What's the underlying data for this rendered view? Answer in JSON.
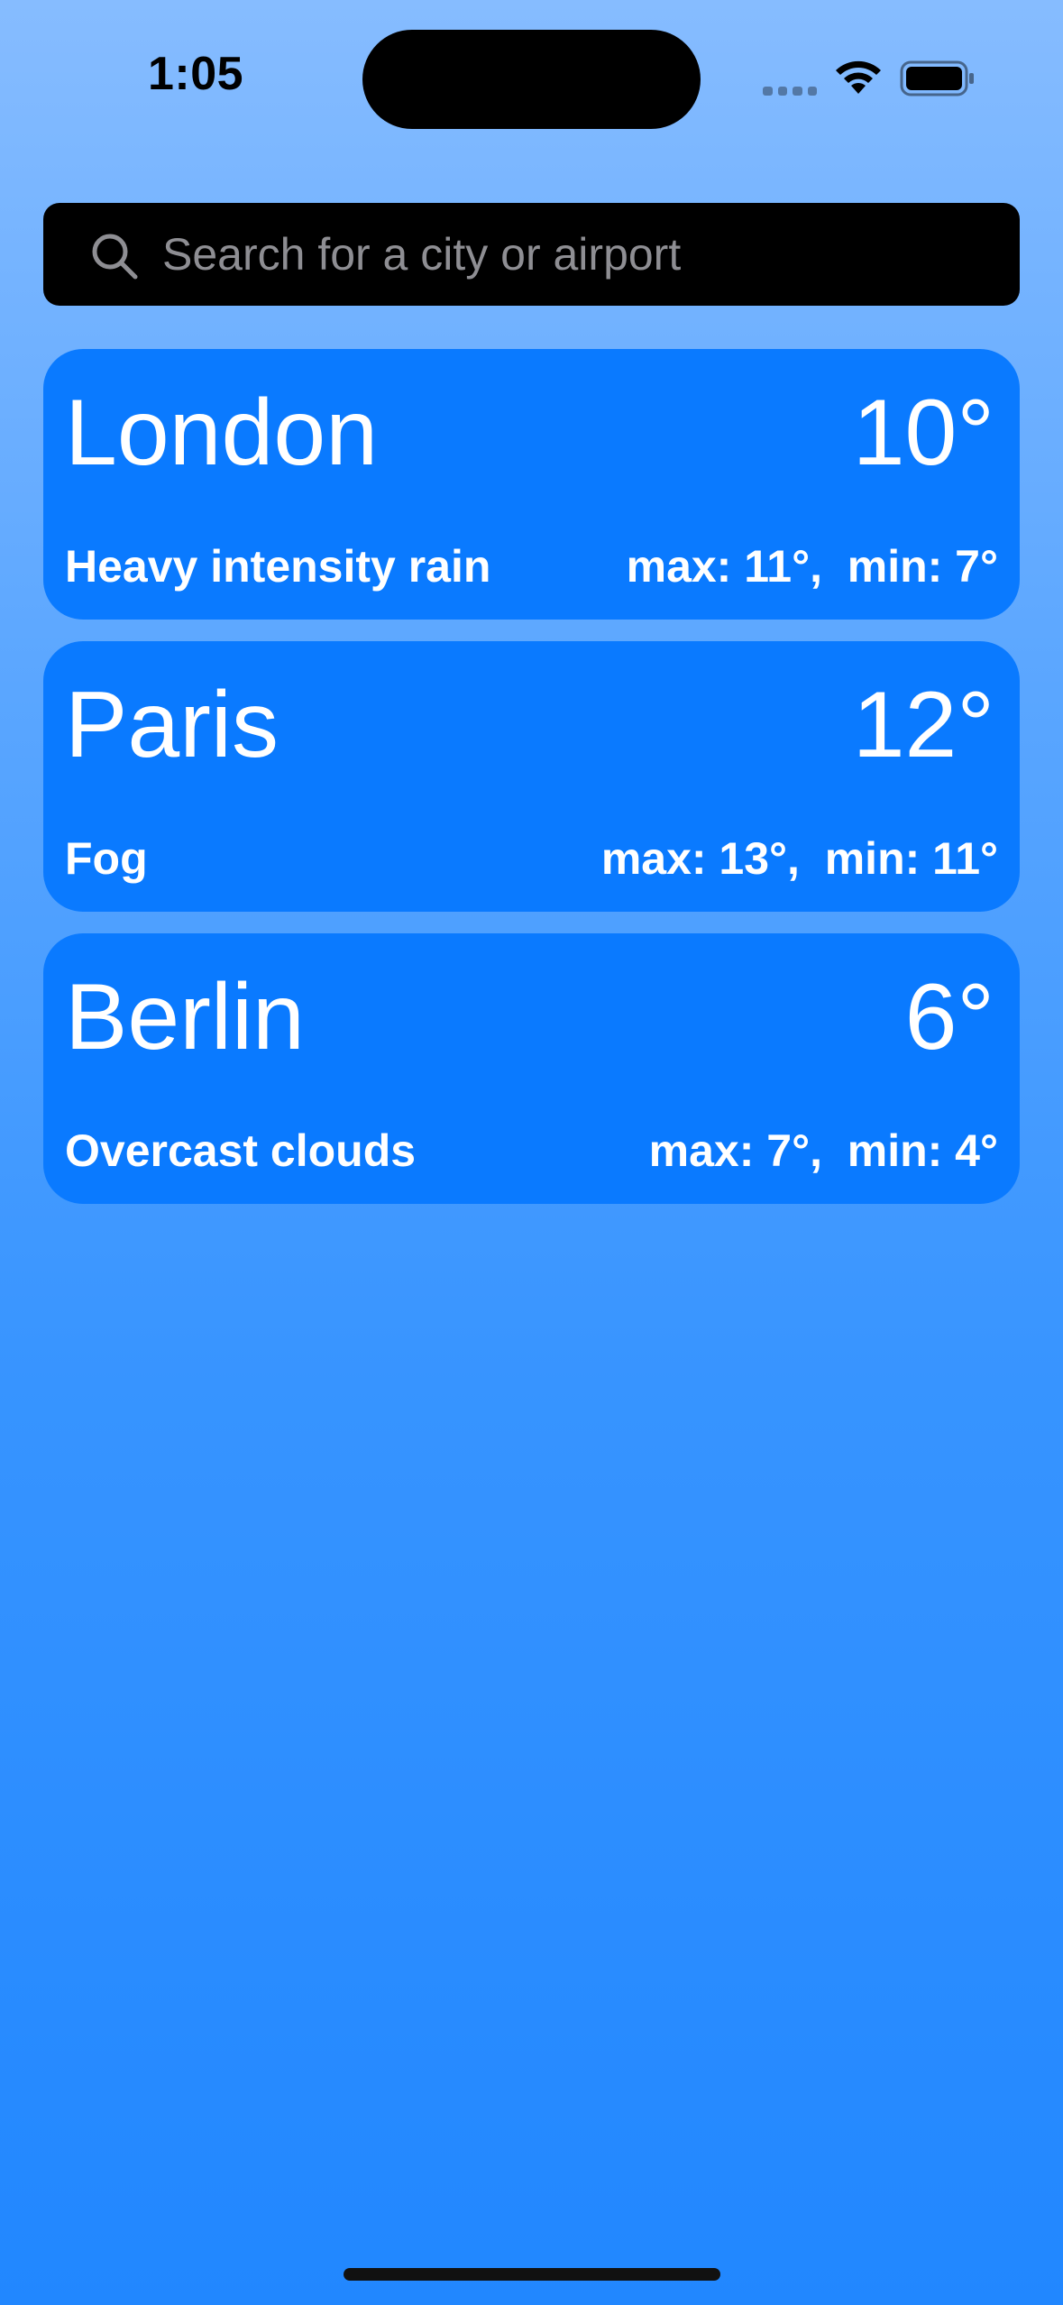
{
  "status_bar": {
    "time": "1:05"
  },
  "search": {
    "placeholder": "Search for a city or airport",
    "value": ""
  },
  "cities": [
    {
      "name": "London",
      "temperature": "10°",
      "description": "Heavy intensity rain",
      "range": "max: 11°,  min: 7°"
    },
    {
      "name": "Paris",
      "temperature": "12°",
      "description": "Fog",
      "range": "max: 13°,  min: 11°"
    },
    {
      "name": "Berlin",
      "temperature": "6°",
      "description": "Overcast clouds",
      "range": "max: 7°,  min: 4°"
    }
  ],
  "colors": {
    "card_background": "#0a7aff",
    "search_background": "#000000",
    "placeholder": "#8e8e93",
    "gradient_top": "#86bcff",
    "gradient_bottom": "#2187ff"
  },
  "icons": {
    "search": "search-icon",
    "wifi": "wifi-icon",
    "battery": "battery-icon"
  }
}
